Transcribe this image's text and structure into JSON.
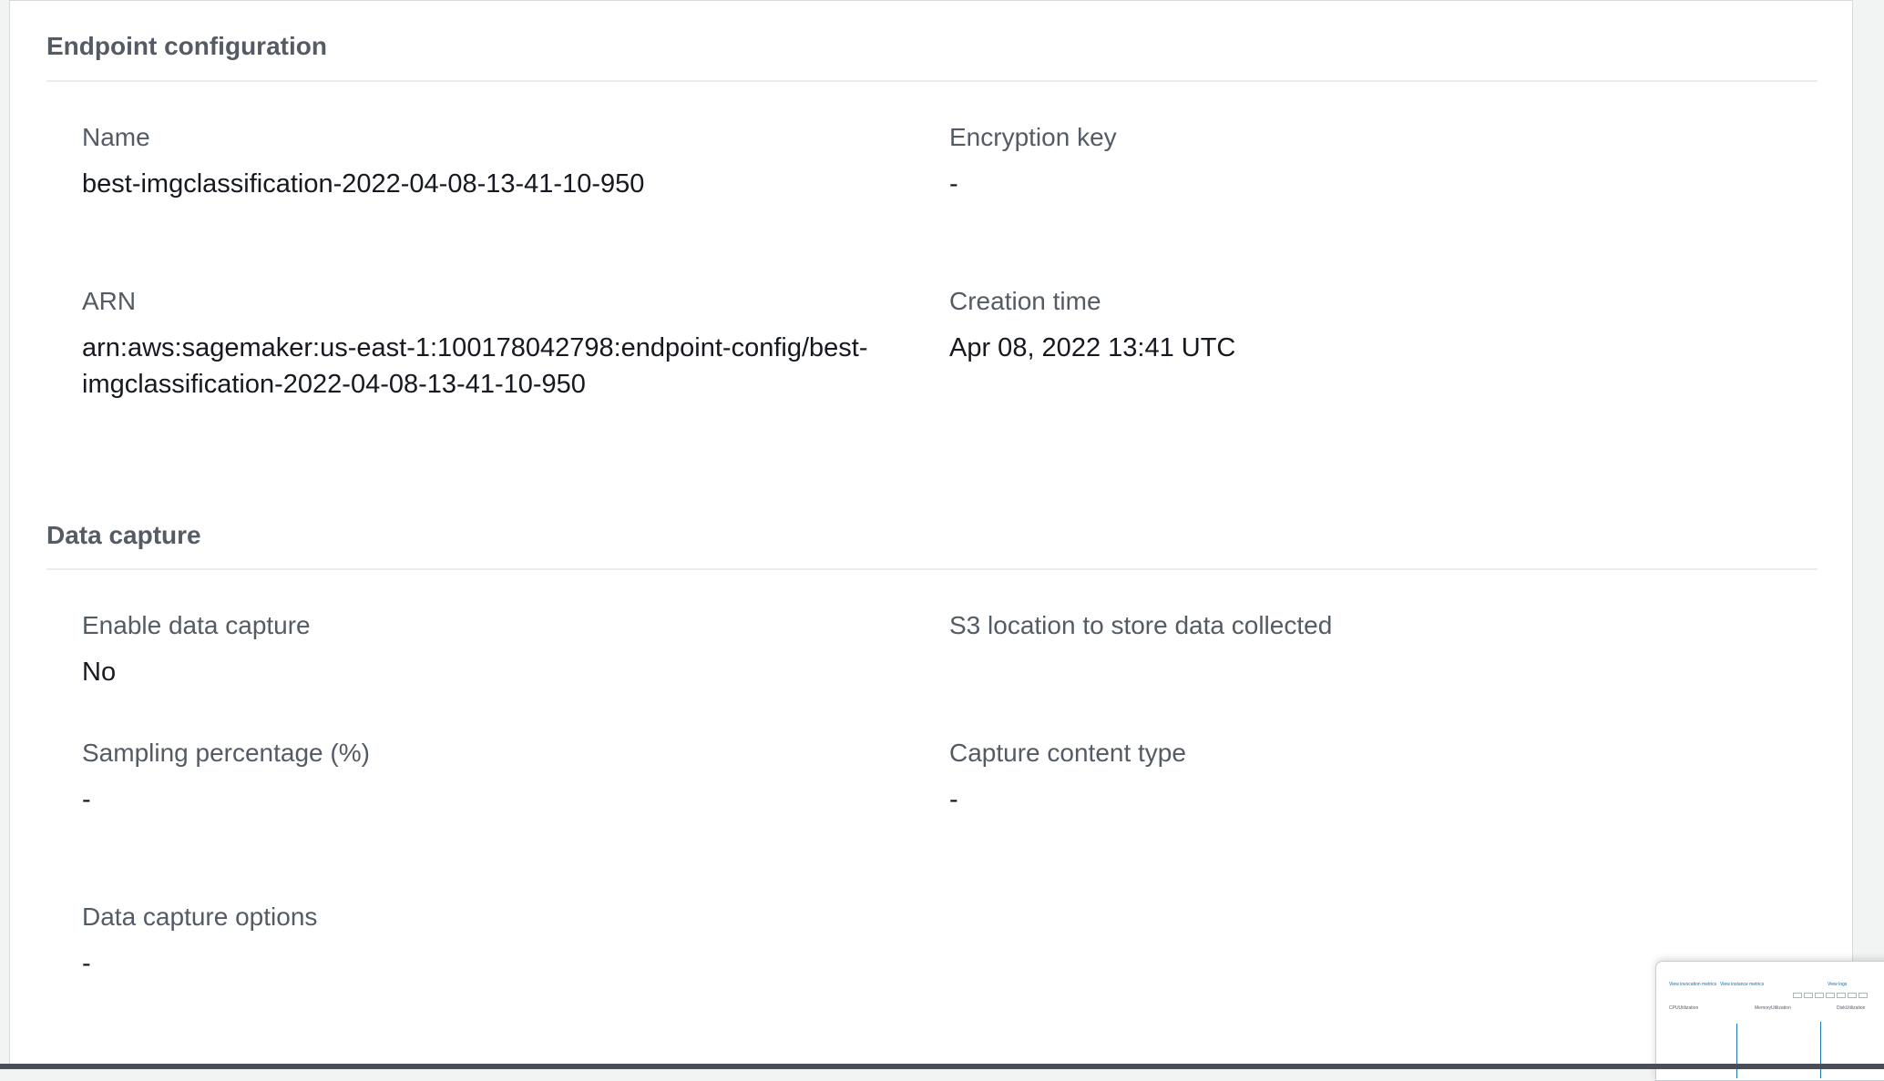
{
  "endpoint_configuration": {
    "title": "Endpoint configuration",
    "name": {
      "label": "Name",
      "value": "best-imgclassification-2022-04-08-13-41-10-950"
    },
    "encryption_key": {
      "label": "Encryption key",
      "value": "-"
    },
    "arn": {
      "label": "ARN",
      "value": "arn:aws:sagemaker:us-east-1:100178042798:endpoint-config/best-imgclassification-2022-04-08-13-41-10-950"
    },
    "creation_time": {
      "label": "Creation time",
      "value": "Apr 08, 2022 13:41 UTC"
    }
  },
  "data_capture": {
    "title": "Data capture",
    "enable": {
      "label": "Enable data capture",
      "value": "No"
    },
    "s3_location": {
      "label": "S3 location to store data collected",
      "value": ""
    },
    "sampling": {
      "label": "Sampling percentage (%)",
      "value": "-"
    },
    "content_type": {
      "label": "Capture content type",
      "value": "-"
    },
    "options": {
      "label": "Data capture options",
      "value": "-"
    }
  },
  "thumbnail": {
    "link_1": "View invocation metrics",
    "link_2": "View instance metrics",
    "link_3": "View logs",
    "chart_1": "CPUUtilization",
    "chart_2": "MemoryUtilization",
    "chart_3": "DiskUtilization"
  },
  "colors": {
    "background": "#f2f3f3",
    "panel": "#ffffff",
    "label": "#545b64",
    "value": "#16191f",
    "divider": "#eaeded"
  }
}
